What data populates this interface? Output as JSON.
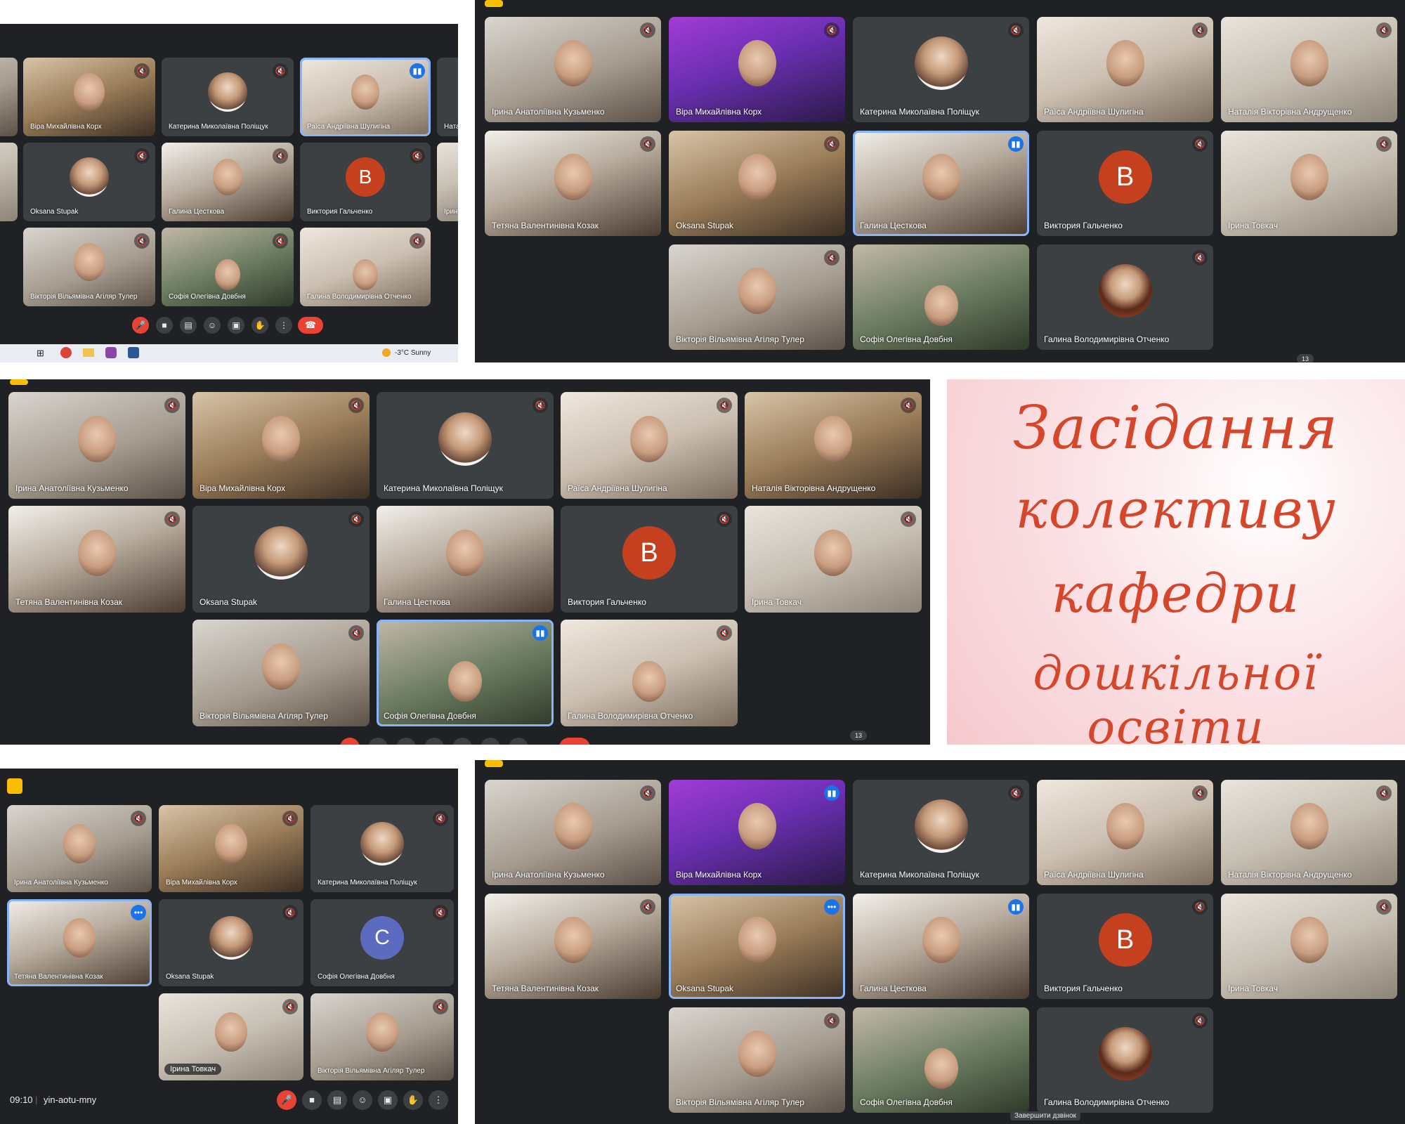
{
  "title_card": {
    "lines": [
      "Засідання",
      "колективу",
      "кафедри",
      "дошкільної освіти"
    ],
    "text_color": "#d5462a"
  },
  "colors": {
    "meet_background": "#202124",
    "tile_background": "#3c4043",
    "active_speaker_border": "#8ab4f8",
    "end_call_red": "#ea4335",
    "avatar_v": "#c5401f",
    "avatar_c": "#5c6bc0",
    "title_card_pink": "#f5c9ce"
  },
  "panel_top_left": {
    "tiles": [
      {
        "name": "Віра Михайлівна Корх"
      },
      {
        "name": "Катерина Миколаївна Поліщук"
      },
      {
        "name": "Раїса Андріївна Шулигіна"
      },
      {
        "name": "Ната"
      },
      {
        "name": "Oksana Stupak"
      },
      {
        "name": "Галина Цесткова"
      },
      {
        "name": "Виктория Гальченко",
        "avatar_letter": "В"
      },
      {
        "name": "Ірин"
      },
      {
        "name": "Вікторія Вільямівна Агіляр Тулер"
      },
      {
        "name": "Софія Олегівна Довбня"
      },
      {
        "name": "Галина Володимирівна Отченко"
      }
    ],
    "controls": [
      "mic-off",
      "camera",
      "captions",
      "emoji",
      "present",
      "raise-hand",
      "more",
      "end-call"
    ],
    "taskbar": {
      "weather": "-3°C Sunny"
    }
  },
  "panel_top_right": {
    "tiles": [
      {
        "name": "Ірина Анатоліївна Кузьменко"
      },
      {
        "name": "Віра Михайлівна Корх"
      },
      {
        "name": "Катерина Миколаївна Поліщук"
      },
      {
        "name": "Раїса Андріївна Шулигіна"
      },
      {
        "name": "Наталія Вікторівна Андрущенко"
      },
      {
        "name": "Тетяна Валентинівна Козак"
      },
      {
        "name": "Oksana Stupak"
      },
      {
        "name": "Галина Цесткова"
      },
      {
        "name": "Виктория Гальченко",
        "avatar_letter": "В"
      },
      {
        "name": "Ірина Товкач"
      },
      {
        "name": "Вікторія Вільямівна Агіляр Тулер"
      },
      {
        "name": "Софія Олегівна Довбня"
      },
      {
        "name": "Галина Володимирівна Отченко"
      }
    ],
    "participant_count": "13"
  },
  "panel_middle": {
    "tiles": [
      {
        "name": "Ірина Анатоліївна Кузьменко"
      },
      {
        "name": "Віра Михайлівна Корх"
      },
      {
        "name": "Катерина Миколаївна Поліщук"
      },
      {
        "name": "Раїса Андріївна Шулигіна"
      },
      {
        "name": "Наталія Вікторівна Андрущенко"
      },
      {
        "name": "Тетяна Валентинівна Козак"
      },
      {
        "name": "Oksana Stupak"
      },
      {
        "name": "Галина Цесткова"
      },
      {
        "name": "Виктория Гальченко",
        "avatar_letter": "В"
      },
      {
        "name": "Ірина Товкач"
      },
      {
        "name": "Вікторія Вільямівна Агіляр Тулер"
      },
      {
        "name": "Софія Олегівна Довбня"
      },
      {
        "name": "Галина Володимирівна Отченко"
      }
    ],
    "participant_count": "13"
  },
  "panel_bottom_left": {
    "tiles": [
      {
        "name": "Ірина Анатоліївна Кузьменко"
      },
      {
        "name": "Віра Михайлівна Корх"
      },
      {
        "name": "Катерина Миколаївна Поліщук"
      },
      {
        "name": "Тетяна Валентинівна Козак"
      },
      {
        "name": "Oksana Stupak"
      },
      {
        "name": "Софія Олегівна Довбня",
        "avatar_letter": "C"
      },
      {
        "name": "Ірина Товкач"
      },
      {
        "name": "Вікторія Вільямівна Агіляр Тулер"
      }
    ],
    "time": "09:10",
    "meeting_code": "yin-aotu-mny",
    "controls": [
      "mic-off",
      "camera",
      "captions",
      "emoji",
      "present",
      "raise-hand",
      "more"
    ]
  },
  "panel_bottom_right": {
    "tiles": [
      {
        "name": "Ірина Анатоліївна Кузьменко"
      },
      {
        "name": "Віра Михайлівна Корх"
      },
      {
        "name": "Катерина Миколаївна Поліщук"
      },
      {
        "name": "Раїса Андріївна Шулигіна"
      },
      {
        "name": "Наталія Вікторівна Андрущенко"
      },
      {
        "name": "Тетяна Валентинівна Козак"
      },
      {
        "name": "Oksana Stupak"
      },
      {
        "name": "Галина Цесткова"
      },
      {
        "name": "Виктория Гальченко",
        "avatar_letter": "В"
      },
      {
        "name": "Ірина Товкач"
      },
      {
        "name": "Вікторія Вільямівна Агіляр Тулер"
      },
      {
        "name": "Софія Олегівна Довбня"
      },
      {
        "name": "Галина Володимирівна Отченко"
      }
    ],
    "end_call_tooltip": "Завершити дзвінок"
  }
}
